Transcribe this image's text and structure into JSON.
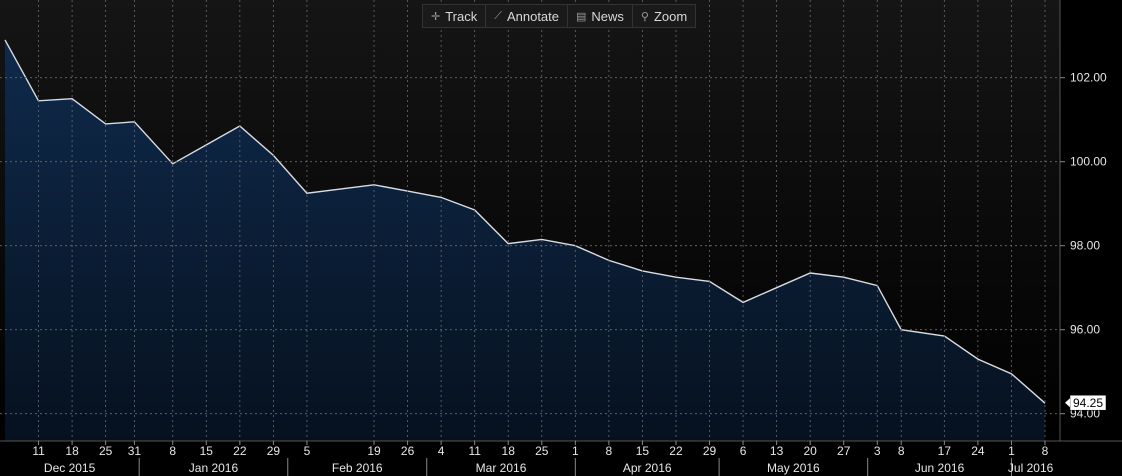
{
  "toolbar": {
    "track_label": "Track",
    "annotate_label": "Annotate",
    "news_label": "News",
    "zoom_label": "Zoom"
  },
  "colors": {
    "background_top": "#151515",
    "background_bottom": "#000000",
    "area_top": "#0f2a4c",
    "area_bottom": "#06111f",
    "line": "#dcdcdc",
    "grid": "#6a6a6a",
    "text": "#e6e6e6",
    "last_value_box": "#ffffff"
  },
  "chart_data": {
    "type": "area",
    "x": [
      "2015-12-04",
      "2015-12-11",
      "2015-12-18",
      "2015-12-25",
      "2015-12-31",
      "2016-01-08",
      "2016-01-15",
      "2016-01-22",
      "2016-01-29",
      "2016-02-05",
      "2016-02-19",
      "2016-02-26",
      "2016-03-04",
      "2016-03-11",
      "2016-03-18",
      "2016-03-25",
      "2016-04-01",
      "2016-04-08",
      "2016-04-15",
      "2016-04-22",
      "2016-04-29",
      "2016-05-06",
      "2016-05-13",
      "2016-05-20",
      "2016-05-27",
      "2016-06-03",
      "2016-06-08",
      "2016-06-17",
      "2016-06-24",
      "2016-07-01",
      "2016-07-08"
    ],
    "series": [
      {
        "values": [
          102.9,
          101.45,
          101.5,
          100.9,
          100.95,
          99.95,
          100.4,
          100.85,
          100.15,
          99.25,
          99.45,
          99.3,
          99.15,
          98.85,
          98.05,
          98.15,
          98.0,
          97.65,
          97.4,
          97.25,
          97.15,
          96.65,
          97.0,
          97.35,
          97.25,
          97.05,
          96.0,
          95.85,
          95.3,
          94.95,
          94.25
        ]
      }
    ],
    "x_tick_labels": [
      "11",
      "18",
      "25",
      "31",
      "8",
      "15",
      "22",
      "29",
      "5",
      "19",
      "26",
      "4",
      "11",
      "18",
      "25",
      "1",
      "8",
      "15",
      "22",
      "29",
      "6",
      "13",
      "20",
      "27",
      "3",
      "8",
      "17",
      "24",
      "1",
      "8"
    ],
    "x_tick_dates": [
      "2015-12-11",
      "2015-12-18",
      "2015-12-25",
      "2015-12-31",
      "2016-01-08",
      "2016-01-15",
      "2016-01-22",
      "2016-01-29",
      "2016-02-05",
      "2016-02-19",
      "2016-02-26",
      "2016-03-04",
      "2016-03-11",
      "2016-03-18",
      "2016-03-25",
      "2016-04-01",
      "2016-04-08",
      "2016-04-15",
      "2016-04-22",
      "2016-04-29",
      "2016-05-06",
      "2016-05-13",
      "2016-05-20",
      "2016-05-27",
      "2016-06-03",
      "2016-06-08",
      "2016-06-17",
      "2016-06-24",
      "2016-07-01",
      "2016-07-08"
    ],
    "month_labels": [
      {
        "label": "Dec 2015",
        "start": "2015-12-01",
        "end": "2016-01-01"
      },
      {
        "label": "Jan 2016",
        "start": "2016-01-01",
        "end": "2016-02-01"
      },
      {
        "label": "Feb 2016",
        "start": "2016-02-01",
        "end": "2016-03-01"
      },
      {
        "label": "Mar 2016",
        "start": "2016-03-01",
        "end": "2016-04-01"
      },
      {
        "label": "Apr 2016",
        "start": "2016-04-01",
        "end": "2016-05-01"
      },
      {
        "label": "May 2016",
        "start": "2016-05-01",
        "end": "2016-06-01"
      },
      {
        "label": "Jun 2016",
        "start": "2016-06-01",
        "end": "2016-07-01"
      },
      {
        "label": "Jul 2016",
        "start": "2016-07-01",
        "end": "2016-07-09"
      }
    ],
    "y_ticks": [
      94,
      96,
      98,
      100,
      102
    ],
    "y_tick_labels": [
      "94.00",
      "96.00",
      "98.00",
      "100.00",
      "102.00"
    ],
    "ylim": [
      93.35,
      103.85
    ],
    "xlim": [
      "2015-12-04",
      "2016-07-08"
    ],
    "last_value_label": "94.25",
    "y_axis_side": "right",
    "grid": true
  }
}
